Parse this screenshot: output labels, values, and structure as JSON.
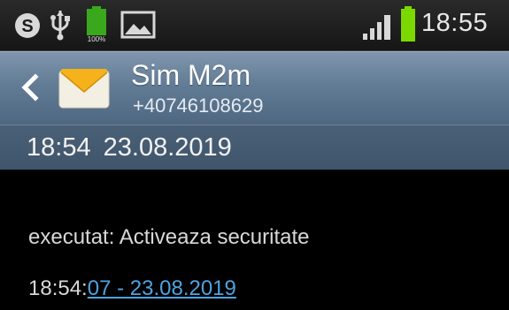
{
  "status_bar": {
    "time": "18:55",
    "icons": [
      "skype-icon",
      "usb-icon",
      "battery-full-icon",
      "image-icon",
      "signal-icon",
      "battery-icon"
    ],
    "battery_full_label": "100%",
    "colors": {
      "battery_green": "#3aa81c",
      "battery_bright": "#7bd800"
    }
  },
  "header": {
    "contact_name": "Sim M2m",
    "contact_number": "+40746108629",
    "back_icon": "chevron-left-icon",
    "avatar_icon": "envelope-icon",
    "background": "#627c95"
  },
  "date_bar": {
    "text": "18:54  23.08.2019"
  },
  "message": {
    "line1": "executat: Activeaza securitate",
    "line2_prefix": "18:54:",
    "line2_link": "07 - 23.08.2019",
    "link_color": "#4fa3e0"
  }
}
